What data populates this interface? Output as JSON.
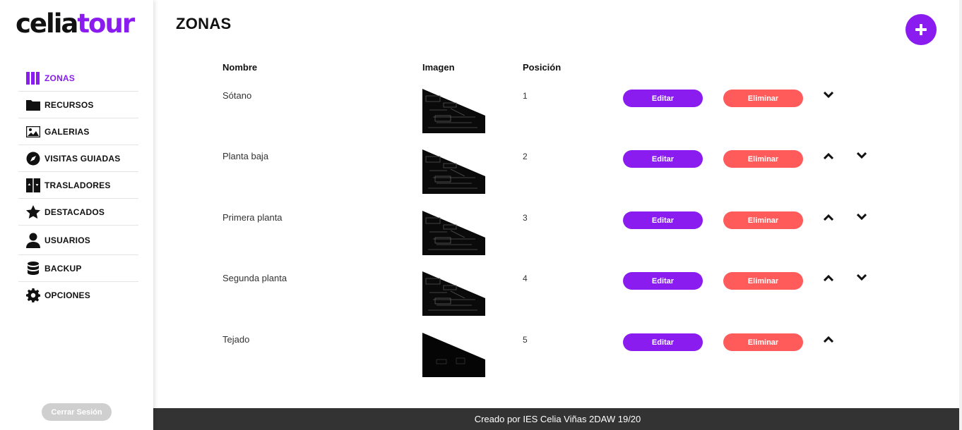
{
  "logo": {
    "part1": "celia",
    "part2": "tour"
  },
  "sidebar": {
    "items": [
      {
        "label": "ZONAS",
        "icon": "columns-icon",
        "active": true
      },
      {
        "label": "RECURSOS",
        "icon": "folder-icon",
        "active": false
      },
      {
        "label": "GALERIAS",
        "icon": "image-icon",
        "active": false
      },
      {
        "label": "VISITAS GUIADAS",
        "icon": "compass-icon",
        "active": false
      },
      {
        "label": "TRASLADORES",
        "icon": "elevator-icon",
        "active": false
      },
      {
        "label": "DESTACADOS",
        "icon": "star-icon",
        "active": false
      },
      {
        "label": "USUARIOS",
        "icon": "user-icon",
        "active": false
      },
      {
        "label": "BACKUP",
        "icon": "database-icon",
        "active": false
      },
      {
        "label": "OPCIONES",
        "icon": "gear-icon",
        "active": false
      }
    ],
    "logout_label": "Cerrar Sesión"
  },
  "main": {
    "title": "ZONAS",
    "add_icon": "plus-icon",
    "columns": {
      "name": "Nombre",
      "image": "Imagen",
      "position": "Posición"
    },
    "rows": [
      {
        "name": "Sótano",
        "position": "1",
        "edit": "Editar",
        "delete": "Eliminar",
        "up": false,
        "down": true
      },
      {
        "name": "Planta baja",
        "position": "2",
        "edit": "Editar",
        "delete": "Eliminar",
        "up": true,
        "down": true
      },
      {
        "name": "Primera planta",
        "position": "3",
        "edit": "Editar",
        "delete": "Eliminar",
        "up": true,
        "down": true
      },
      {
        "name": "Segunda planta",
        "position": "4",
        "edit": "Editar",
        "delete": "Eliminar",
        "up": true,
        "down": true
      },
      {
        "name": "Tejado",
        "position": "5",
        "edit": "Editar",
        "delete": "Eliminar",
        "up": true,
        "down": false
      }
    ]
  },
  "footer": {
    "text": "Creado por IES Celia Viñas 2DAW 19/20"
  },
  "colors": {
    "accent": "#8a1cf0",
    "danger": "#ff5b5b",
    "footer": "#333333"
  }
}
